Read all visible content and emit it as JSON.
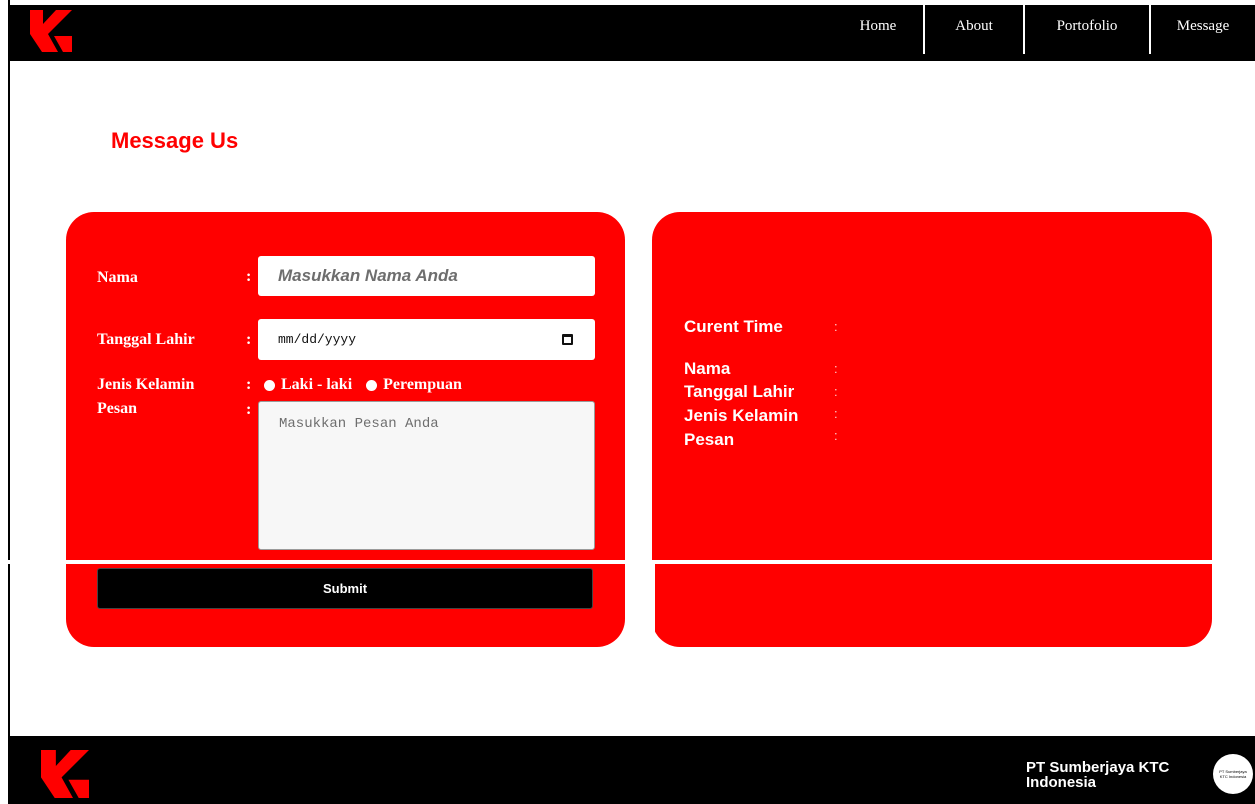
{
  "nav": {
    "home": "Home",
    "about": "About",
    "portfolio": "Portofolio",
    "message": "Message"
  },
  "page": {
    "title": "Message Us"
  },
  "form": {
    "nama_label": "Nama",
    "nama_placeholder": "Masukkan Nama Anda",
    "tanggal_label": "Tanggal Lahir",
    "tanggal_placeholder": "mm/dd/yyyy",
    "jenis_label": "Jenis Kelamin",
    "gender_male": "Laki - laki",
    "gender_female": "Perempuan",
    "pesan_label": "Pesan",
    "pesan_placeholder": "Masukkan Pesan Anda",
    "separator": ":",
    "submit_label": "Submit"
  },
  "output": {
    "time_label": "Curent Time",
    "nama_label": "Nama",
    "tanggal_label": "Tanggal Lahir",
    "jenis_label": "Jenis Kelamin",
    "pesan_label": "Pesan",
    "separator": ":"
  },
  "footer": {
    "company_name": "PT Sumberjaya KTC Indonesia",
    "badge_text": "PT Sumberjaya KTC Indonesia"
  },
  "colors": {
    "accent": "#ff0000",
    "header_bg": "#000000",
    "text_light": "#ffffff"
  },
  "icons": {
    "logo": "ktc-logo-icon",
    "calendar": "calendar-icon"
  }
}
